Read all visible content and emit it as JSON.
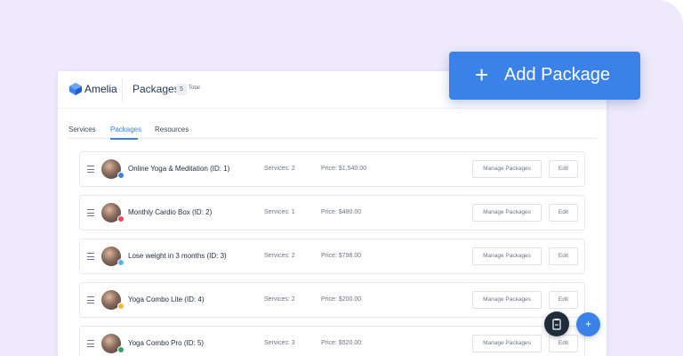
{
  "app": {
    "brand": "Amelia",
    "page_title": "Packages",
    "count": "5",
    "count_label": "Total"
  },
  "tabs": [
    "Services",
    "Packages",
    "Resources"
  ],
  "active_tab": "Packages",
  "add_button": {
    "label": "Add Package",
    "icon": "plus-icon"
  },
  "packages": [
    {
      "name": "Online Yoga & Meditation (ID: 1)",
      "services": "Services: 2",
      "price": "Price: $1,540.00",
      "color": "#3b82e8"
    },
    {
      "name": "Monthly Cardio Box (ID: 2)",
      "services": "Services: 1",
      "price": "Price: $480.00",
      "color": "#e84a5a"
    },
    {
      "name": "Lose weight in 3 months (ID: 3)",
      "services": "Services: 2",
      "price": "Price: $798.00",
      "color": "#5ab4e8"
    },
    {
      "name": "Yoga Combo Lite (ID: 4)",
      "services": "Services: 2",
      "price": "Price: $200.00",
      "color": "#f5b83d"
    },
    {
      "name": "Yoga Combo Pro (ID: 5)",
      "services": "Services: 3",
      "price": "Price: $520.00",
      "color": "#2ea86a"
    }
  ],
  "row_actions": {
    "manage": "Manage Packages",
    "edit": "Edit"
  },
  "fabs": {
    "dark_icon": "clipboard-icon",
    "blue_icon": "plus-icon",
    "blue_label": "+"
  },
  "colors": {
    "accent": "#3b82e8",
    "background": "#efeafb"
  }
}
